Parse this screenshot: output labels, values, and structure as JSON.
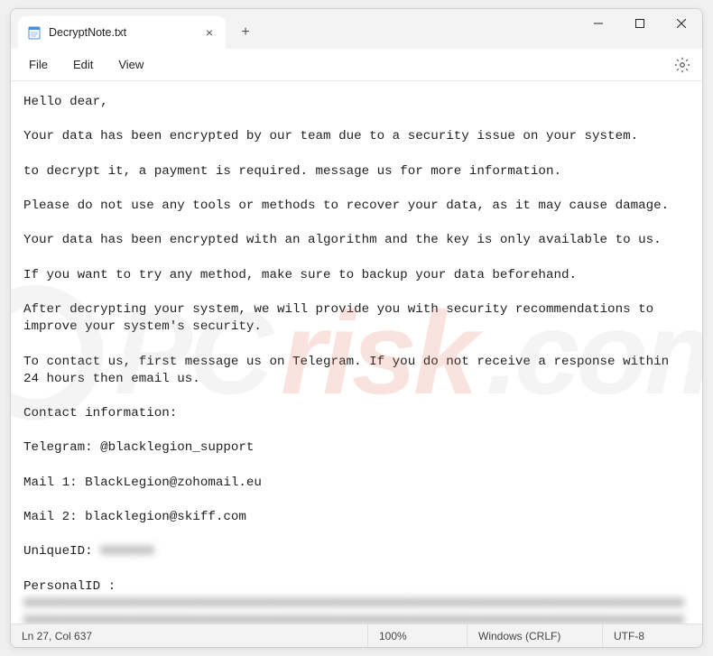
{
  "titlebar": {
    "tab_title": "DecryptNote.txt",
    "tab_close": "×",
    "tab_add": "+"
  },
  "menu": {
    "file": "File",
    "edit": "Edit",
    "view": "View"
  },
  "note": {
    "l1": "Hello dear,",
    "l2": "Your data has been encrypted by our team due to a security issue on your system.",
    "l3": "to decrypt it, a payment is required. message us for more information.",
    "l4": "Please do not use any tools or methods to recover your data, as it may cause damage.",
    "l5": "Your data has been encrypted with an algorithm and the key is only available to us.",
    "l6": "If you want to try any method, make sure to backup your data beforehand.",
    "l7": "After decrypting your system, we will provide you with security recommendations to improve your system's security.",
    "l8": "To contact us, first message us on Telegram. If you do not receive a response within 24 hours then email us.",
    "l9": "Contact information:",
    "l10": "Telegram: @blacklegion_support",
    "l11": "Mail 1: BlackLegion@zohomail.eu",
    "l12": "Mail 2: blacklegion@skiff.com",
    "l13_label": "UniqueID: ",
    "l13_val": "XXXXXXX",
    "l14_label": "PersonalID :",
    "l14_val": "XXXXXXXXXXXXXXXXXXXXXXXXXXXXXXXXXXXXXXXXXXXXXXXXXXXXXXXXXXXXXXXXXXXXXXXXXXXXXXXXXXXXXXXXXXXXXXXXXXXXXXXXXXXXXXXXXXXXXXXXXXXXXXXXXXXXXXXXXXXXXXXXXXXXXXXXXXXXXXXXXXXXXXXXXXXXXXXXXXXXXXXXXXXXXX"
  },
  "status": {
    "pos": "Ln 27, Col 637",
    "zoom": "100%",
    "eol": "Windows (CRLF)",
    "enc": "UTF-8"
  },
  "watermark": {
    "pc": "PC",
    "risk": "risk",
    "com": ".com"
  }
}
